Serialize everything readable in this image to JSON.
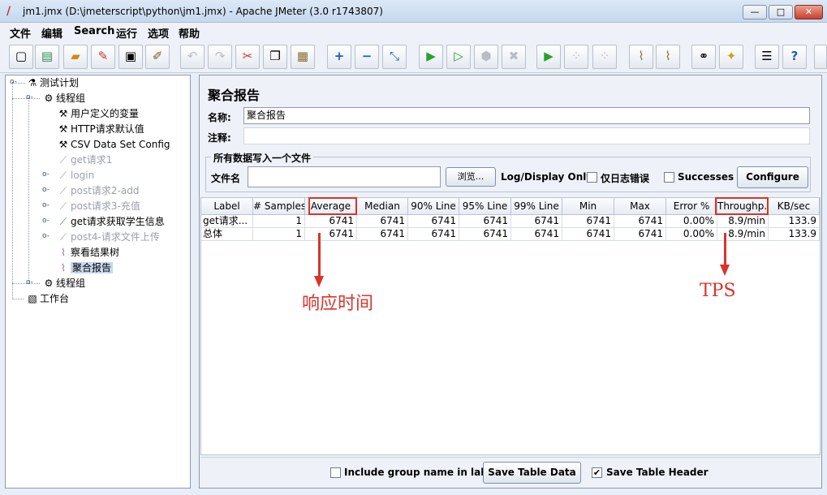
{
  "window": {
    "title": "jm1.jmx (D:\\jmeterscript\\python\\jm1.jmx) - Apache JMeter (3.0 r1743807)",
    "minimize": "—",
    "maximize": "□",
    "close": "✕"
  },
  "menu": [
    "文件",
    "编辑",
    "Search",
    "运行",
    "选项",
    "帮助"
  ],
  "toolbar_icons": [
    "new-icon",
    "templates-icon",
    "open-icon",
    "close-file-icon",
    "save-icon",
    "save-as-icon",
    "undo-icon",
    "redo-icon",
    "cut-icon",
    "copy-icon",
    "paste-icon",
    "expand-icon",
    "collapse-icon",
    "toggle-icon",
    "start-icon",
    "start-no-pause-icon",
    "stop-icon",
    "shutdown-icon",
    "remote-start-icon",
    "remote-stop-icon",
    "remote-shutdown-icon",
    "clear-icon",
    "clear-all-icon",
    "search-icon",
    "reset-search-icon",
    "function-helper-icon",
    "help-icon"
  ],
  "tree": {
    "items": [
      {
        "label": "测试计划"
      },
      {
        "label": "线程组"
      },
      {
        "label": "用户定义的变量"
      },
      {
        "label": "HTTP请求默认值"
      },
      {
        "label": "CSV Data Set Config"
      },
      {
        "label": "get请求1"
      },
      {
        "label": "login"
      },
      {
        "label": "post请求2-add"
      },
      {
        "label": "post请求3-充值"
      },
      {
        "label": "get请求获取学生信息"
      },
      {
        "label": "post4-请求文件上传"
      },
      {
        "label": "察看结果树"
      },
      {
        "label": "聚合报告"
      },
      {
        "label": "线程组"
      },
      {
        "label": "工作台"
      }
    ]
  },
  "panel": {
    "title": "聚合报告",
    "name_label": "名称:",
    "name_value": "聚合报告",
    "comment_label": "注释:",
    "comment_value": "",
    "file_group_title": "所有数据写入一个文件",
    "filename_label": "文件名",
    "filename_value": "",
    "browse_button": "浏览...",
    "log_display_label": "Log/Display Only:",
    "errors_only_label": "仅日志错误",
    "successes_label": "Successes",
    "configure_button": "Configure"
  },
  "table": {
    "headers": [
      "Label",
      "# Samples",
      "Average",
      "Median",
      "90% Line",
      "95% Line",
      "99% Line",
      "Min",
      "Max",
      "Error %",
      "Throughp...",
      "KB/sec"
    ],
    "rows": [
      [
        "get请求...",
        "1",
        "6741",
        "6741",
        "6741",
        "6741",
        "6741",
        "6741",
        "6741",
        "0.00%",
        "8.9/min",
        "133.9"
      ],
      [
        "总体",
        "1",
        "6741",
        "6741",
        "6741",
        "6741",
        "6741",
        "6741",
        "6741",
        "0.00%",
        "8.9/min",
        "133.9"
      ]
    ]
  },
  "annotations": {
    "response_time": "响应时间",
    "tps": "TPS",
    "color": "#d9342b"
  },
  "footer": {
    "include_group_label": "Include group name in label?",
    "include_group_checked": false,
    "save_table_data": "Save Table Data",
    "save_table_header_label": "Save Table Header",
    "save_table_header_checked": true
  }
}
